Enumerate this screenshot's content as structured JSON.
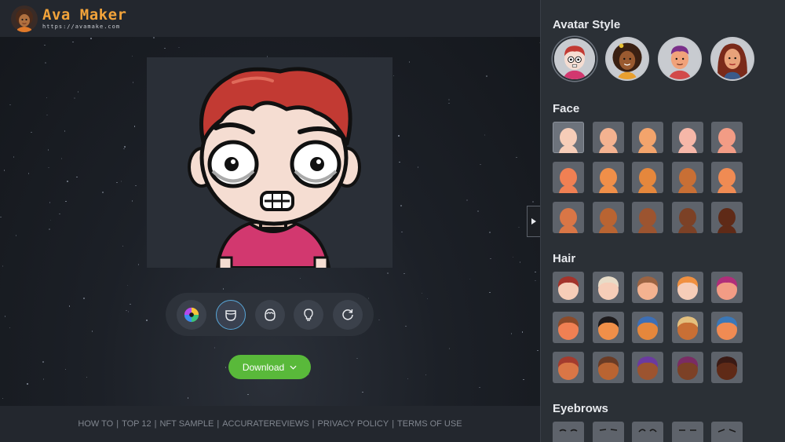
{
  "app": {
    "title": "Ava Maker",
    "url": "https://avamake.com"
  },
  "toolbar": {
    "tools": [
      "color-wheel",
      "face-shape",
      "head-outline",
      "idea-bulb",
      "refresh"
    ],
    "active": "face-shape"
  },
  "download": {
    "label": "Download"
  },
  "footer": {
    "links": [
      "HOW TO",
      "TOP 12",
      "NFT SAMPLE",
      "ACCURATEREVIEWS",
      "PRIVACY POLICY",
      "TERMS OF USE"
    ]
  },
  "panel": {
    "avatar_style": {
      "title": "Avatar Style",
      "options": [
        "cartoon-boy",
        "curly-girl",
        "man-cartoon",
        "woman-cartoon"
      ],
      "selected": 0
    },
    "face": {
      "title": "Face",
      "skin_tones": [
        "#f6cdb8",
        "#f3b290",
        "#f3a46c",
        "#f6b7a8",
        "#f29c85",
        "#f08053",
        "#f08f49",
        "#e5873c",
        "#c86f35",
        "#f08b53",
        "#d97646",
        "#b96432",
        "#9c5430",
        "#7c4126",
        "#5f2a17"
      ],
      "selected": 0
    },
    "hair": {
      "title": "Hair",
      "colors": [
        "#a3332b",
        "#e8dcc8",
        "#9b6342",
        "#f09040",
        "#b02e7a",
        "#8a4a2a",
        "#1d1a1c",
        "#3d6fb6",
        "#e4c07e",
        "#3b78b8",
        "#a33b2e",
        "#6a3b25",
        "#6b3aa0",
        "#7a2c64",
        "#3a1a14"
      ],
      "faces": [
        "#f6cdb8",
        "#f6cdb8",
        "#f3b290",
        "#f6cdb8",
        "#f29c85",
        "#f08053",
        "#f08f49",
        "#e5873c",
        "#c86f35",
        "#f08b53",
        "#d97646",
        "#b96432",
        "#9c5430",
        "#7c4126",
        "#5f2a17"
      ]
    },
    "eyebrows": {
      "title": "Eyebrows"
    }
  }
}
